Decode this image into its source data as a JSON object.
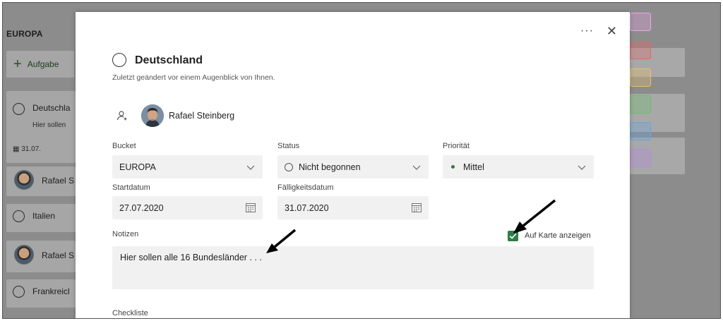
{
  "board": {
    "bucket_title": "EUROPA",
    "add_task_label": "Aufgabe",
    "cards": [
      {
        "title": "Deutschla",
        "note": "Hier sollen",
        "date": "31.07.",
        "assignee": "Rafael S"
      },
      {
        "title": "Italien",
        "assignee": "Rafael S"
      },
      {
        "title": "Frankreicl"
      }
    ]
  },
  "labels": {
    "colors": [
      "#e9a6e6",
      "#e06a6a",
      "#e3c16a",
      "#6bbf6b",
      "#6aa6e0",
      "#b48ae0"
    ]
  },
  "modal": {
    "more_icon": "more-icon",
    "close_icon": "close-icon",
    "title": "Deutschland",
    "subtitle": "Zuletzt geändert vor einem Augenblick von Ihnen.",
    "assignee": "Rafael Steinberg",
    "bucket": {
      "label": "Bucket",
      "value": "EUROPA"
    },
    "status": {
      "label": "Status",
      "value": "Nicht begonnen"
    },
    "priority": {
      "label": "Priorität",
      "value": "Mittel"
    },
    "start": {
      "label": "Startdatum",
      "value": "27.07.2020"
    },
    "due": {
      "label": "Fälligkeitsdatum",
      "value": "31.07.2020"
    },
    "notes": {
      "label": "Notizen",
      "value": "Hier sollen alle 16 Bundesländer . . ."
    },
    "show_on_card": {
      "label": "Auf Karte anzeigen",
      "checked": true
    },
    "checklist_label": "Checkliste"
  }
}
